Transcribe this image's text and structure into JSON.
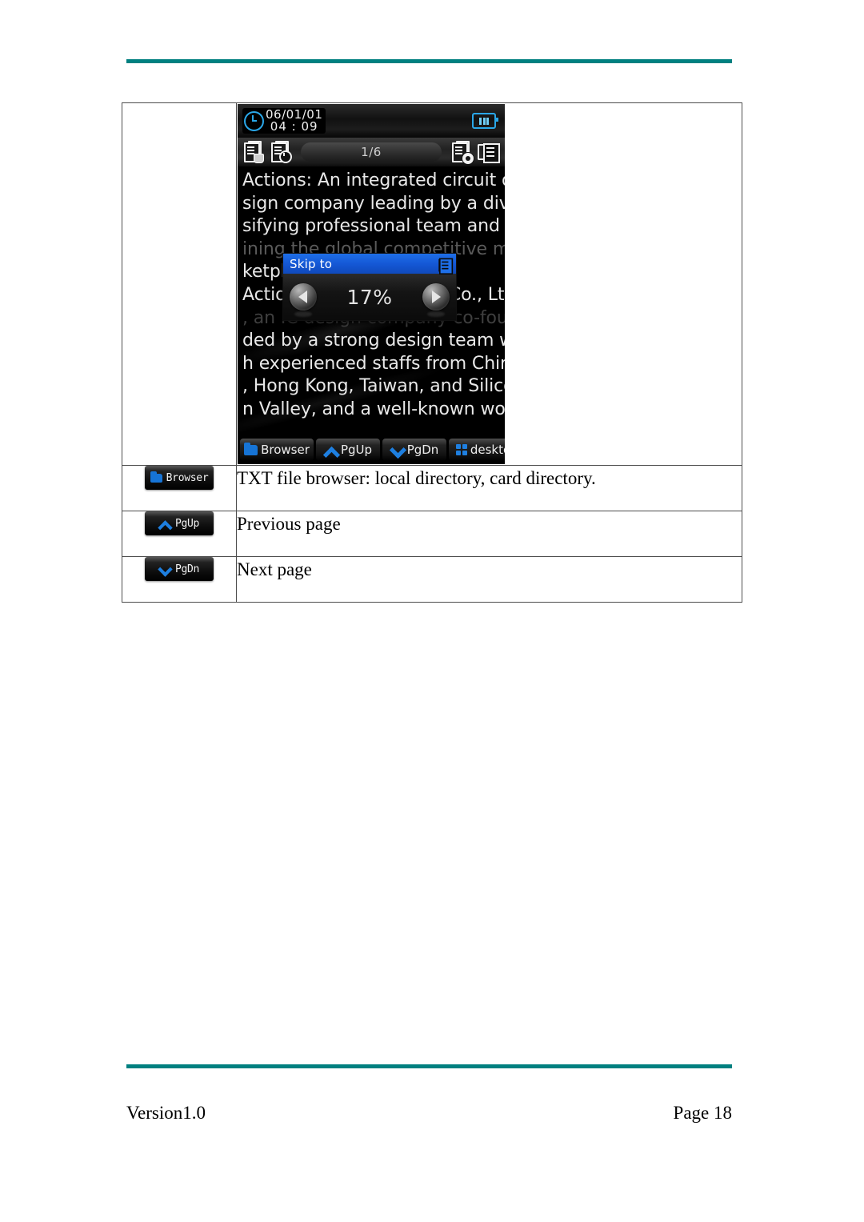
{
  "document": {
    "footer": {
      "version": "Version1.0",
      "page": "Page 18"
    }
  },
  "device_screenshot": {
    "status_bar": {
      "date": "06/01/01",
      "time": "04 : 09",
      "clock_icon": "clock-icon",
      "battery_icon": "battery-icon"
    },
    "toolbar": {
      "bookmark_icon": "bookmark-doc-icon",
      "history_icon": "recent-doc-icon",
      "page_indicator": "1/6",
      "settings_icon": "doc-settings-gear-icon",
      "skipto_icon": "skip-to-icon"
    },
    "reader_text": [
      "Actions: An integrated circuit de",
      "sign company leading by a diver",
      "sifying professional team and jo",
      "ining the global competitive mar",
      "ketplace.",
      "Actions Semiconductor Co., Ltd.",
      ", an IC design company co-foun",
      "ded by a strong design team wit",
      "h experienced staffs from China",
      ", Hong Kong, Taiwan, and Silico",
      "n Valley, and a well-known worl"
    ],
    "popup": {
      "title": "Skip to",
      "title_icon": "skip-to-icon",
      "prev_icon": "arrow-left-icon",
      "next_icon": "arrow-right-icon",
      "percent": "17%"
    },
    "softkeys": [
      {
        "label": "Browser",
        "icon": "folder-icon"
      },
      {
        "label": "PgUp",
        "icon": "chevron-up-icon"
      },
      {
        "label": "PgDn",
        "icon": "chevron-down-icon"
      },
      {
        "label": "deskto",
        "icon": "grid-icon"
      }
    ]
  },
  "table": {
    "rows": [
      {
        "button_label": "Browser",
        "button_icon": "folder-icon",
        "description": "TXT file browser: local directory, card directory."
      },
      {
        "button_label": "PgUp",
        "button_icon": "chevron-up-icon",
        "description": "Previous page"
      },
      {
        "button_label": "PgDn",
        "button_icon": "chevron-down-icon",
        "description": "Next page"
      }
    ]
  },
  "colors": {
    "rule": "#008080",
    "accent_blue": "#1558d6",
    "icon_blue": "#1e7fe0"
  }
}
